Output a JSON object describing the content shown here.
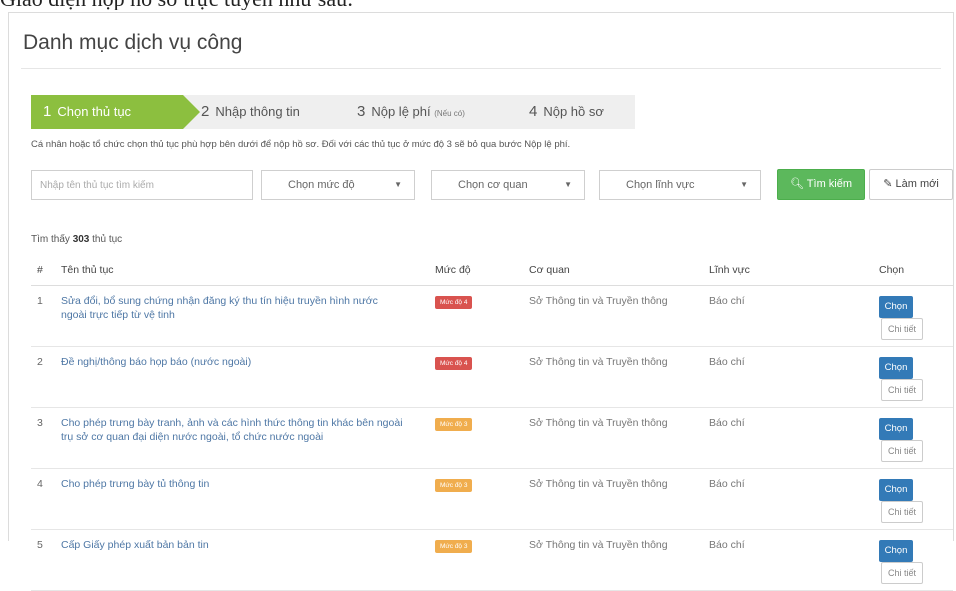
{
  "caption": "Giao diện nộp hồ sơ trực tuyến như sau:",
  "title": "Danh mục dịch vụ công",
  "steps": [
    {
      "num": "1",
      "label": "Chọn thủ tục",
      "note": ""
    },
    {
      "num": "2",
      "label": "Nhập thông tin",
      "note": ""
    },
    {
      "num": "3",
      "label": "Nộp lệ phí",
      "note": "(Nếu có)"
    },
    {
      "num": "4",
      "label": "Nộp hồ sơ",
      "note": ""
    }
  ],
  "description": "Cá nhân hoặc tổ chức chọn thủ tục phù hợp bên dưới để nộp hồ sơ. Đối với các thủ tục ở mức độ 3 sẽ bỏ qua bước Nộp lệ phí.",
  "filters": {
    "search_placeholder": "Nhập tên thủ tục tìm kiếm",
    "level": "Chọn mức độ",
    "agency": "Chọn cơ quan",
    "field": "Chọn lĩnh vực",
    "search_button": "Tìm kiếm",
    "reset_button": "Làm mới"
  },
  "found": {
    "prefix": "Tìm thấy",
    "count": "303",
    "suffix": "thủ tục"
  },
  "table": {
    "headers": {
      "num": "#",
      "name": "Tên thủ tục",
      "level": "Mức độ",
      "agency": "Cơ quan",
      "field": "Lĩnh vực",
      "select": "Chọn"
    },
    "rows": [
      {
        "num": "1",
        "name": "Sửa đổi, bổ sung chứng nhận đăng ký thu tín hiệu truyền hình nước ngoài trực tiếp từ vệ tinh",
        "level": "Mức độ 4",
        "level_color": "#d9534f",
        "agency": "Sở Thông tin và Truyền thông",
        "field": "Báo chí",
        "select": "Chọn",
        "detail": "Chi tiết"
      },
      {
        "num": "2",
        "name": "Đề nghị/thông báo họp báo (nước ngoài)",
        "level": "Mức độ 4",
        "level_color": "#d9534f",
        "agency": "Sở Thông tin và Truyền thông",
        "field": "Báo chí",
        "select": "Chọn",
        "detail": "Chi tiết"
      },
      {
        "num": "3",
        "name": "Cho phép trưng bày tranh, ảnh và các hình thức thông tin khác bên ngoài trụ sở cơ quan đại diện nước ngoài, tổ chức nước ngoài",
        "level": "Mức độ 3",
        "level_color": "#f0ad4e",
        "agency": "Sở Thông tin và Truyền thông",
        "field": "Báo chí",
        "select": "Chọn",
        "detail": "Chi tiết"
      },
      {
        "num": "4",
        "name": "Cho phép trưng bày tủ thông tin",
        "level": "Mức độ 3",
        "level_color": "#f0ad4e",
        "agency": "Sở Thông tin và Truyền thông",
        "field": "Báo chí",
        "select": "Chọn",
        "detail": "Chi tiết"
      },
      {
        "num": "5",
        "name": "Cấp Giấy phép xuất bản bản tin",
        "level": "Mức độ 3",
        "level_color": "#f0ad4e",
        "agency": "Sở Thông tin và Truyền thông",
        "field": "Báo chí",
        "select": "Chọn",
        "detail": "Chi tiết"
      }
    ]
  }
}
